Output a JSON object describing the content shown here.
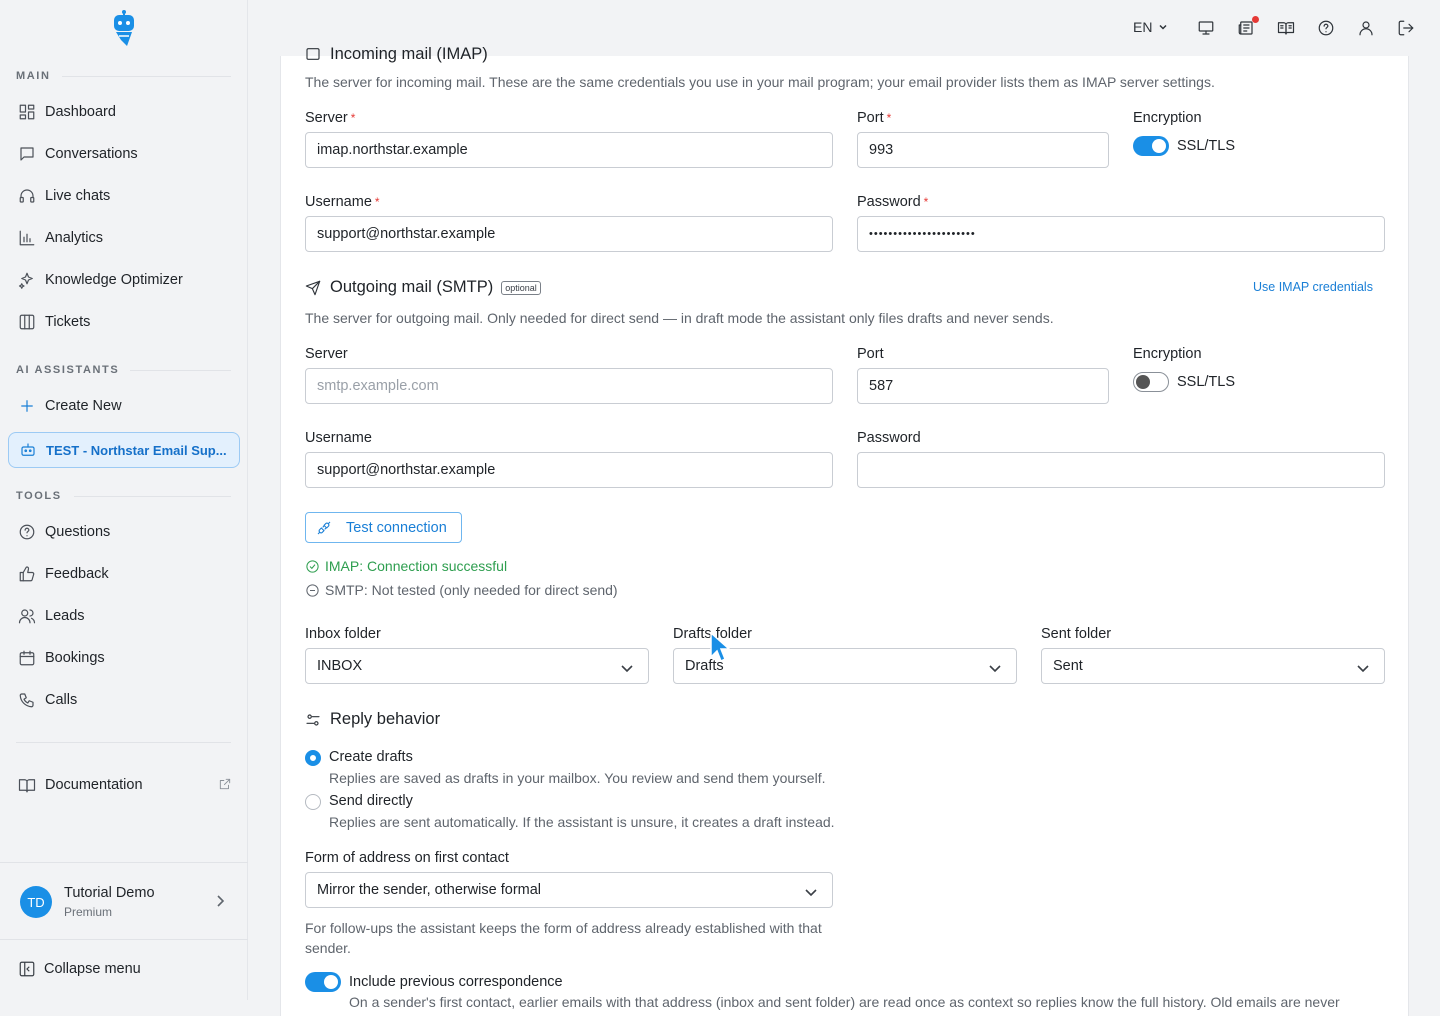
{
  "sidebar": {
    "sections": {
      "main": "MAIN",
      "ai": "AI ASSISTANTS",
      "tools": "TOOLS"
    },
    "main_items": [
      {
        "label": "Dashboard",
        "icon": "dashboard-icon"
      },
      {
        "label": "Conversations",
        "icon": "chat-bubble-icon"
      },
      {
        "label": "Live chats",
        "icon": "headset-icon"
      },
      {
        "label": "Analytics",
        "icon": "bar-chart-icon"
      },
      {
        "label": "Knowledge Optimizer",
        "icon": "sparkles-icon"
      },
      {
        "label": "Tickets",
        "icon": "columns-icon"
      }
    ],
    "ai_items": [
      {
        "label": "Create New",
        "icon": "plus-icon"
      },
      {
        "label": "TEST - Northstar Email Sup...",
        "icon": "robot-icon"
      }
    ],
    "tool_items": [
      {
        "label": "Questions",
        "icon": "help-circle-icon"
      },
      {
        "label": "Feedback",
        "icon": "thumbs-up-icon"
      },
      {
        "label": "Leads",
        "icon": "users-icon"
      },
      {
        "label": "Bookings",
        "icon": "calendar-icon"
      },
      {
        "label": "Calls",
        "icon": "phone-icon"
      }
    ],
    "documentation": "Documentation",
    "user": {
      "initials": "TD",
      "name": "Tutorial Demo",
      "plan": "Premium"
    },
    "collapse": "Collapse menu"
  },
  "topbar": {
    "language": "EN"
  },
  "imap": {
    "title_partial": "Incoming mail (IMAP)",
    "description": "The server for incoming mail. These are the same credentials you use in your mail program; your email provider lists them as IMAP server settings.",
    "server_label": "Server",
    "server_value": "imap.northstar.example",
    "port_label": "Port",
    "port_value": "993",
    "encryption_label": "Encryption",
    "encryption_option": "SSL/TLS",
    "encryption_on": true,
    "username_label": "Username",
    "username_value": "support@northstar.example",
    "password_label": "Password",
    "password_value": "••••••••••••••••••••••"
  },
  "smtp": {
    "title": "Outgoing mail (SMTP)",
    "badge": "optional",
    "use_imap_link": "Use IMAP credentials",
    "description": "The server for outgoing mail. Only needed for direct send — in draft mode the assistant only files drafts and never sends.",
    "server_label": "Server",
    "server_placeholder": "smtp.example.com",
    "port_label": "Port",
    "port_value": "587",
    "encryption_label": "Encryption",
    "encryption_option": "SSL/TLS",
    "encryption_on": false,
    "username_label": "Username",
    "username_value": "support@northstar.example",
    "password_label": "Password",
    "password_value": ""
  },
  "test_connection": "Test connection",
  "status": {
    "imap": "IMAP: Connection successful",
    "smtp": "SMTP: Not tested (only needed for direct send)",
    "success_color": "#2e9e4f",
    "neutral_color": "#5f656d"
  },
  "folders": {
    "inbox_label": "Inbox folder",
    "inbox_value": "INBOX",
    "drafts_label": "Drafts folder",
    "drafts_value": "Drafts",
    "sent_label": "Sent folder",
    "sent_value": "Sent"
  },
  "reply": {
    "title": "Reply behavior",
    "options": [
      {
        "label": "Create drafts",
        "desc": "Replies are saved as drafts in your mailbox. You review and send them yourself.",
        "selected": true
      },
      {
        "label": "Send directly",
        "desc": "Replies are sent automatically. If the assistant is unsure, it creates a draft instead.",
        "selected": false
      }
    ],
    "address_label": "Form of address on first contact",
    "address_value": "Mirror the sender, otherwise formal",
    "address_help": "For follow-ups the assistant keeps the form of address already established with that sender.",
    "include_label": "Include previous correspondence",
    "include_on": true,
    "include_desc_partial": "On a sender's first contact, earlier emails with that address (inbox and sent folder) are read once as context so replies know the full history. Old emails are never"
  },
  "accent_color": "#1a8fe6"
}
